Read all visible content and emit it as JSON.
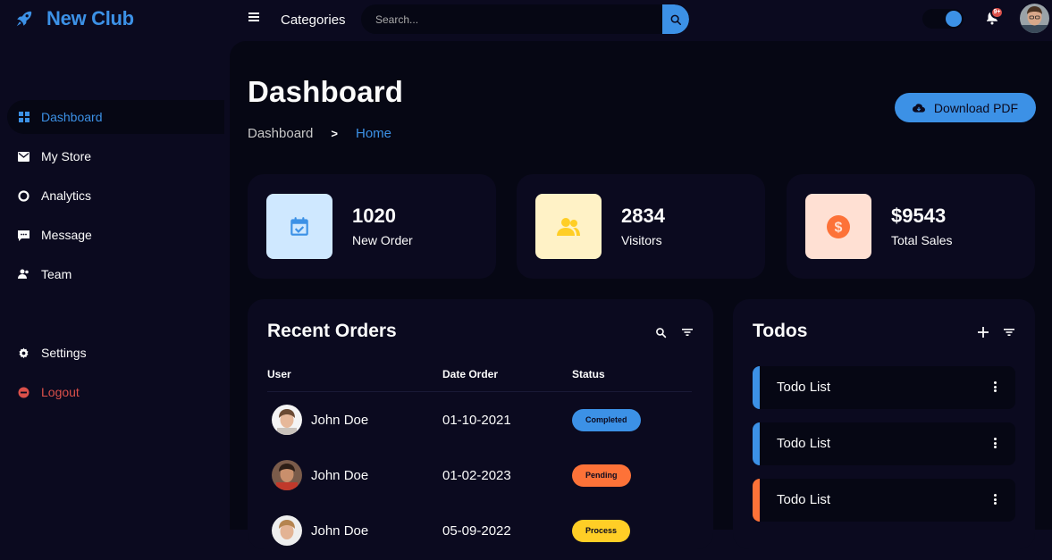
{
  "colors": {
    "accent": "#3c91e6",
    "background": "#0b0a1f",
    "panel": "#060714",
    "danger": "#db504a",
    "orange": "#fd7238",
    "yellow": "#ffce26",
    "light_blue": "#cfe8ff",
    "light_yellow": "#fff2c6",
    "light_orange": "#ffe0d3"
  },
  "brand": {
    "name": "New Club",
    "icon": "rocket-icon"
  },
  "topbar": {
    "categories_label": "Categories",
    "search_placeholder": "Search...",
    "notification_count": "9+"
  },
  "sidebar": {
    "items": [
      {
        "label": "Dashboard",
        "icon": "dashboard-icon"
      },
      {
        "label": "My Store",
        "icon": "store-icon"
      },
      {
        "label": "Analytics",
        "icon": "analytics-icon"
      },
      {
        "label": "Message",
        "icon": "message-icon"
      },
      {
        "label": "Team",
        "icon": "team-icon"
      }
    ],
    "settings_label": "Settings",
    "logout_label": "Logout"
  },
  "main": {
    "title": "Dashboard",
    "breadcrumb": {
      "first": "Dashboard",
      "separator": ">",
      "active": "Home"
    },
    "download_label": "Download PDF"
  },
  "stats": [
    {
      "value": "1020",
      "label": "New Order",
      "icon": "calendar-check-icon"
    },
    {
      "value": "2834",
      "label": "Visitors",
      "icon": "group-icon"
    },
    {
      "value": "$9543",
      "label": "Total Sales",
      "icon": "dollar-icon"
    }
  ],
  "orders": {
    "title": "Recent Orders",
    "columns": [
      "User",
      "Date Order",
      "Status"
    ],
    "rows": [
      {
        "user": "John Doe",
        "date": "01-10-2021",
        "status": "Completed"
      },
      {
        "user": "John Doe",
        "date": "01-02-2023",
        "status": "Pending"
      },
      {
        "user": "John Doe",
        "date": "05-09-2022",
        "status": "Process"
      }
    ]
  },
  "todos": {
    "title": "Todos",
    "items": [
      {
        "text": "Todo List",
        "state": "completed"
      },
      {
        "text": "Todo List",
        "state": "completed"
      },
      {
        "text": "Todo List",
        "state": "not-completed"
      }
    ]
  }
}
